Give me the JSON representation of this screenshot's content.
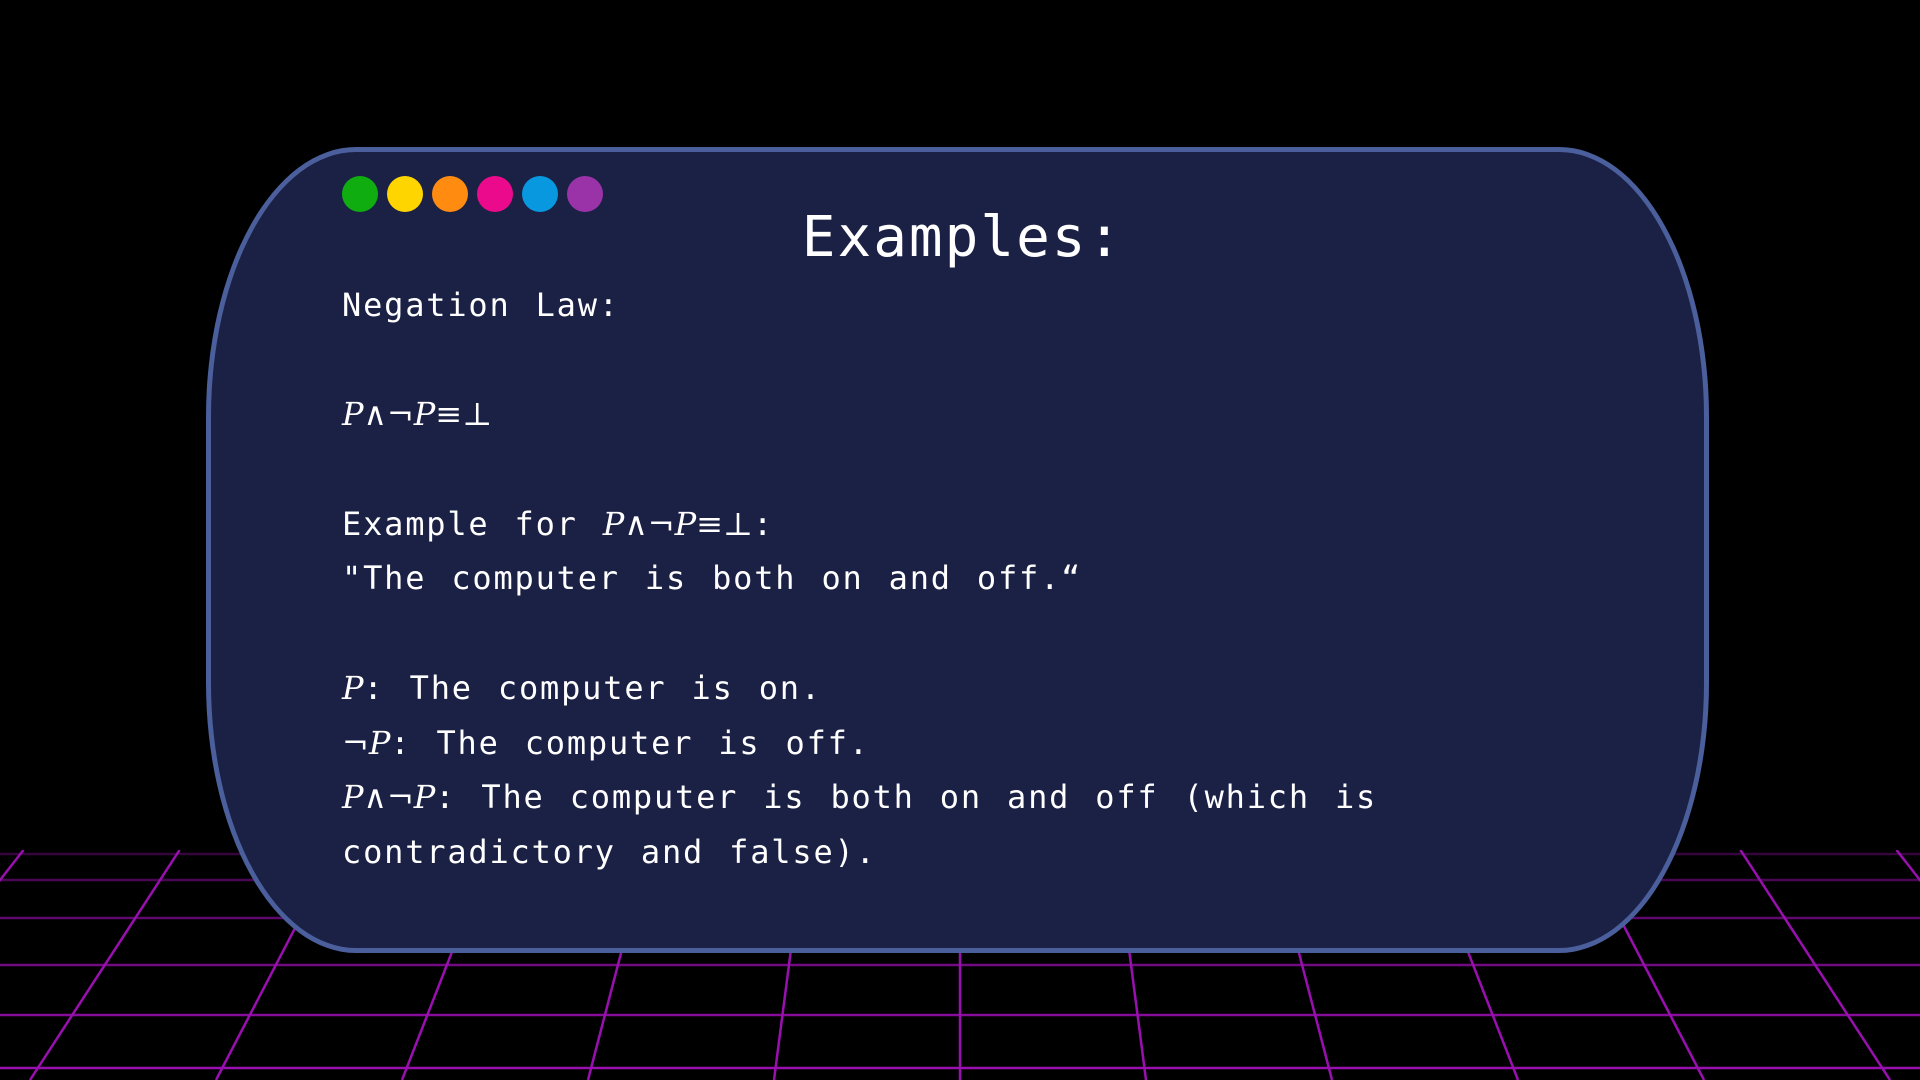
{
  "window_controls": {
    "dots": [
      {
        "name": "green-dot",
        "color": "#10ad10"
      },
      {
        "name": "yellow-dot",
        "color": "#ffd500"
      },
      {
        "name": "orange-dot",
        "color": "#ff8c10"
      },
      {
        "name": "pink-dot",
        "color": "#ec0a8c"
      },
      {
        "name": "blue-dot",
        "color": "#0898e0"
      },
      {
        "name": "purple-dot",
        "color": "#9a33a8"
      }
    ]
  },
  "slide": {
    "title": "Examples:",
    "law_heading": "Negation Law:",
    "law_formula": "P∧¬P≡⊥",
    "example_prefix": "Example for ",
    "example_formula": "P∧¬P≡⊥",
    "example_suffix": ":",
    "quote": "\"The computer is both on and off.“",
    "p_symbol": "P",
    "p_text": ": The computer is on.",
    "not_p_symbol": "¬P",
    "not_p_text": ": The computer is off.",
    "conj_symbol": "P∧¬P",
    "conj_text": ": The computer is both on and off (which is contradictory and false)."
  },
  "colors": {
    "background": "#000000",
    "card_fill": "#1b2045",
    "card_border": "#4a5f9c",
    "grid_line": "#9a0fb0",
    "text": "#ffffff"
  }
}
